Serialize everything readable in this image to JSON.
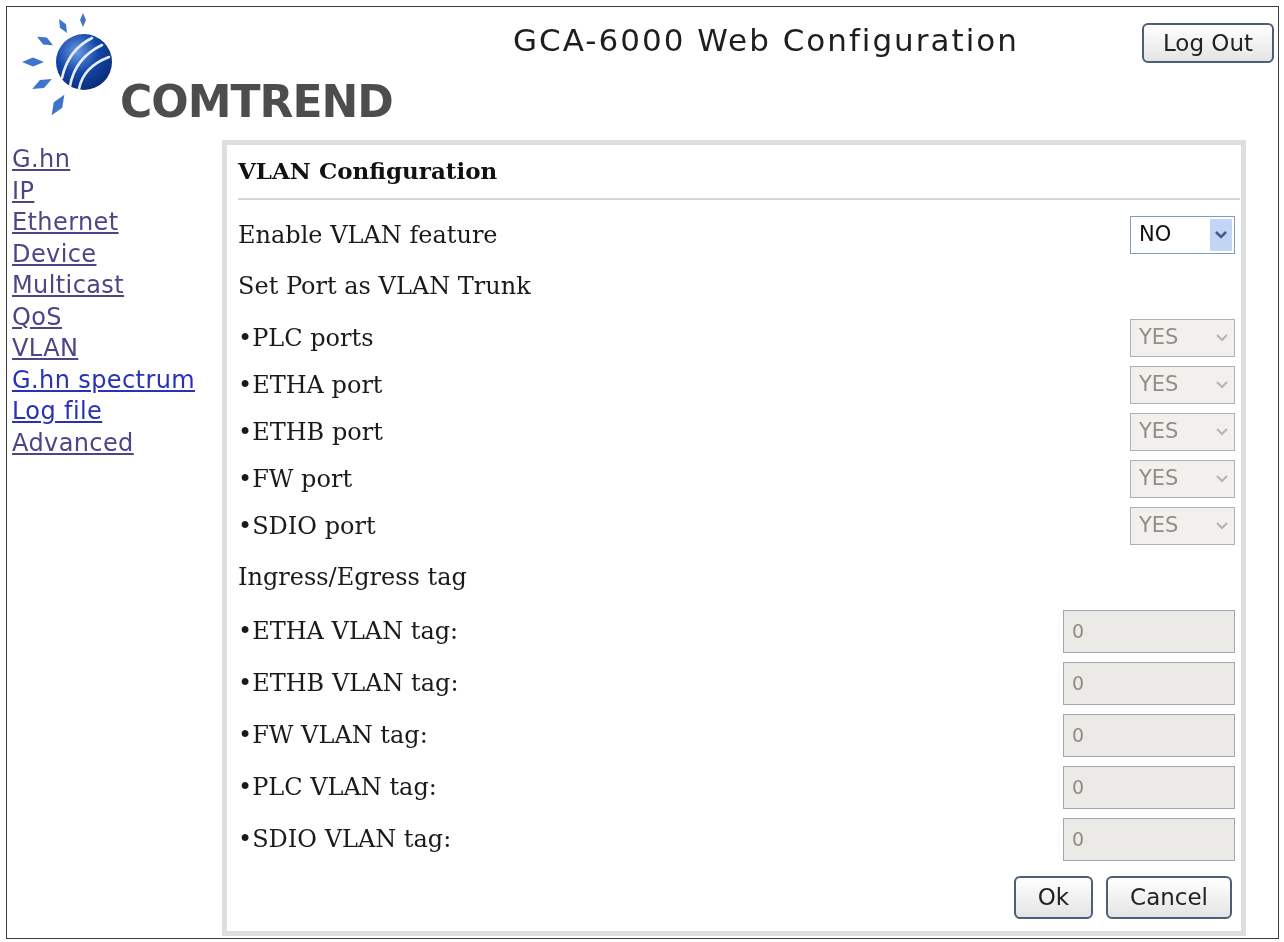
{
  "header": {
    "logo_text": "COMTREND",
    "title": "GCA-6000 Web Configuration",
    "logout_button": "Log Out"
  },
  "sidebar": {
    "items": [
      {
        "label": "G.hn",
        "visited": true
      },
      {
        "label": "IP",
        "visited": true
      },
      {
        "label": "Ethernet",
        "visited": true
      },
      {
        "label": "Device",
        "visited": true
      },
      {
        "label": "Multicast",
        "visited": true
      },
      {
        "label": "QoS",
        "visited": true
      },
      {
        "label": "VLAN",
        "visited": true
      },
      {
        "label": "G.hn spectrum",
        "visited": false
      },
      {
        "label": "Log file",
        "visited": false
      },
      {
        "label": "Advanced",
        "visited": true
      }
    ]
  },
  "panel": {
    "title": "VLAN Configuration",
    "rows": [
      {
        "kind": "select",
        "label": "Enable VLAN feature",
        "value": "NO",
        "disabled": false
      },
      {
        "kind": "heading",
        "label": "Set Port as VLAN Trunk"
      },
      {
        "kind": "select",
        "label": "•PLC ports",
        "value": "YES",
        "disabled": true
      },
      {
        "kind": "select",
        "label": "•ETHA port",
        "value": "YES",
        "disabled": true
      },
      {
        "kind": "select",
        "label": "•ETHB port",
        "value": "YES",
        "disabled": true
      },
      {
        "kind": "select",
        "label": "•FW port",
        "value": "YES",
        "disabled": true
      },
      {
        "kind": "select",
        "label": "•SDIO port",
        "value": "YES",
        "disabled": true
      },
      {
        "kind": "heading",
        "label": "Ingress/Egress tag"
      },
      {
        "kind": "text",
        "label": "•ETHA VLAN tag:",
        "value": "0",
        "disabled": true
      },
      {
        "kind": "text",
        "label": "•ETHB VLAN tag:",
        "value": "0",
        "disabled": true
      },
      {
        "kind": "text",
        "label": "•FW VLAN tag:",
        "value": "0",
        "disabled": true
      },
      {
        "kind": "text",
        "label": "•PLC VLAN tag:",
        "value": "0",
        "disabled": true
      },
      {
        "kind": "text",
        "label": "•SDIO VLAN tag:",
        "value": "0",
        "disabled": true
      }
    ],
    "buttons": [
      "Ok",
      "Cancel"
    ]
  }
}
